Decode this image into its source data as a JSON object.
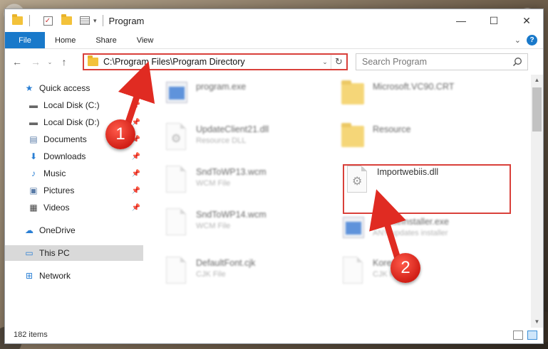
{
  "window": {
    "title": "Program",
    "controls": {
      "minimize": "—",
      "maximize": "☐",
      "close": "✕"
    }
  },
  "ribbon": {
    "tabs": [
      "File",
      "Home",
      "Share",
      "View"
    ],
    "help": "?"
  },
  "address": {
    "path": "C:\\Program Files\\Program Directory",
    "search_placeholder": "Search Program"
  },
  "sidebar": {
    "items": [
      {
        "label": "Quick access",
        "icon": "star-icon",
        "pinned": false
      },
      {
        "label": "Local Disk (C:)",
        "icon": "drive-icon",
        "pinned": true
      },
      {
        "label": "Local Disk (D:)",
        "icon": "drive-icon",
        "pinned": true
      },
      {
        "label": "Documents",
        "icon": "documents-icon",
        "pinned": true
      },
      {
        "label": "Downloads",
        "icon": "download-icon",
        "pinned": true
      },
      {
        "label": "Music",
        "icon": "music-icon",
        "pinned": true
      },
      {
        "label": "Pictures",
        "icon": "pictures-icon",
        "pinned": true
      },
      {
        "label": "Videos",
        "icon": "videos-icon",
        "pinned": true
      },
      {
        "label": "OneDrive",
        "icon": "cloud-icon",
        "pinned": false
      },
      {
        "label": "This PC",
        "icon": "pc-icon",
        "pinned": false,
        "selected": true
      },
      {
        "label": "Network",
        "icon": "network-icon",
        "pinned": false
      }
    ]
  },
  "files": [
    {
      "name": "program.exe",
      "type": "",
      "icon": "exe-icon"
    },
    {
      "name": "Microsoft.VC90.CRT",
      "type": "",
      "icon": "folder-icon"
    },
    {
      "name": "UpdateClient21.dll",
      "type": "Resource DLL",
      "icon": "dll-icon"
    },
    {
      "name": "Resource",
      "type": "",
      "icon": "folder-icon"
    },
    {
      "name": "SndToWP13.wcm",
      "type": "WCM File",
      "icon": "file-icon"
    },
    {
      "name": "Importwebiis.dll",
      "type": "",
      "icon": "dll-icon"
    },
    {
      "name": "SndToWP14.wcm",
      "type": "WCM File",
      "icon": "file-icon"
    },
    {
      "name": "UpdateInstaller.exe",
      "type": "ANY updates installer",
      "icon": "exe-icon"
    },
    {
      "name": "DefaultFont.cjk",
      "type": "CJK File",
      "icon": "file-icon"
    },
    {
      "name": "Korean",
      "type": "CJK File",
      "icon": "file-icon"
    }
  ],
  "status": {
    "count": "182 items"
  },
  "annotations": {
    "step1": "1",
    "step2": "2"
  },
  "colors": {
    "accent": "#1979ca",
    "highlight": "#d9403a"
  }
}
